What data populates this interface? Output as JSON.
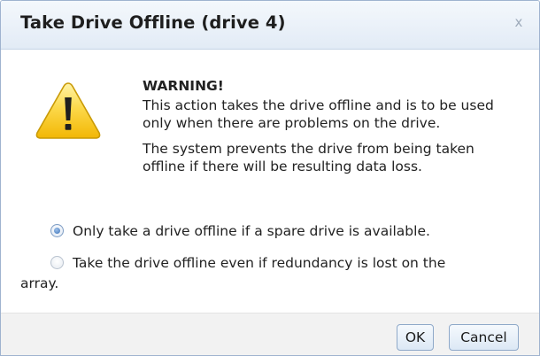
{
  "dialog": {
    "title": "Take Drive Offline (drive 4)",
    "close_glyph": "x"
  },
  "warning": {
    "icon": "warning-triangle-icon",
    "heading": "WARNING!",
    "paragraph1": "This action takes the drive offline and is to be used only when there are problems on the drive.",
    "paragraph2": "The system prevents the drive from being taken offline if there will be resulting data loss."
  },
  "options": [
    {
      "label": "Only take a drive offline if a spare drive is available.",
      "selected": true
    },
    {
      "label_line1": "Take the drive offline even if redundancy is lost on the",
      "label_line2": "array.",
      "selected": false
    }
  ],
  "buttons": {
    "ok_label": "OK",
    "cancel_label": "Cancel"
  },
  "colors": {
    "title_bar": "#e2ebf6",
    "warning_yellow": "#f7c614",
    "button_border": "#8fa9c9",
    "radio_selected": "#3e73b8"
  }
}
